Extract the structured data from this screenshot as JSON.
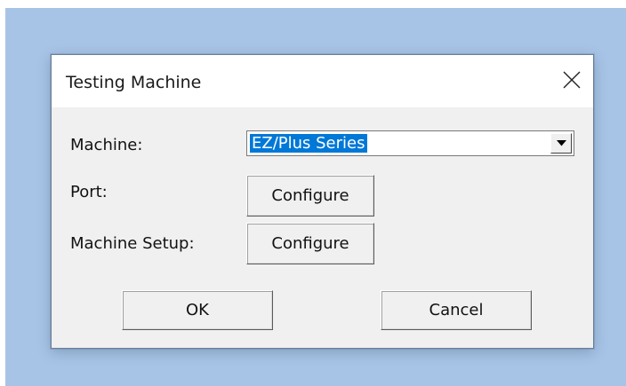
{
  "dialog": {
    "title": "Testing Machine",
    "close_icon": "close-icon"
  },
  "fields": {
    "machine_label": "Machine:",
    "machine_value": "EZ/Plus Series",
    "port_label": "Port:",
    "port_button": "Configure",
    "setup_label": "Machine Setup:",
    "setup_button": "Configure"
  },
  "buttons": {
    "ok": "OK",
    "cancel": "Cancel"
  },
  "colors": {
    "desktop": "#a7c4e6",
    "dialog_bg": "#f0f0f0",
    "selection": "#0078d7"
  }
}
